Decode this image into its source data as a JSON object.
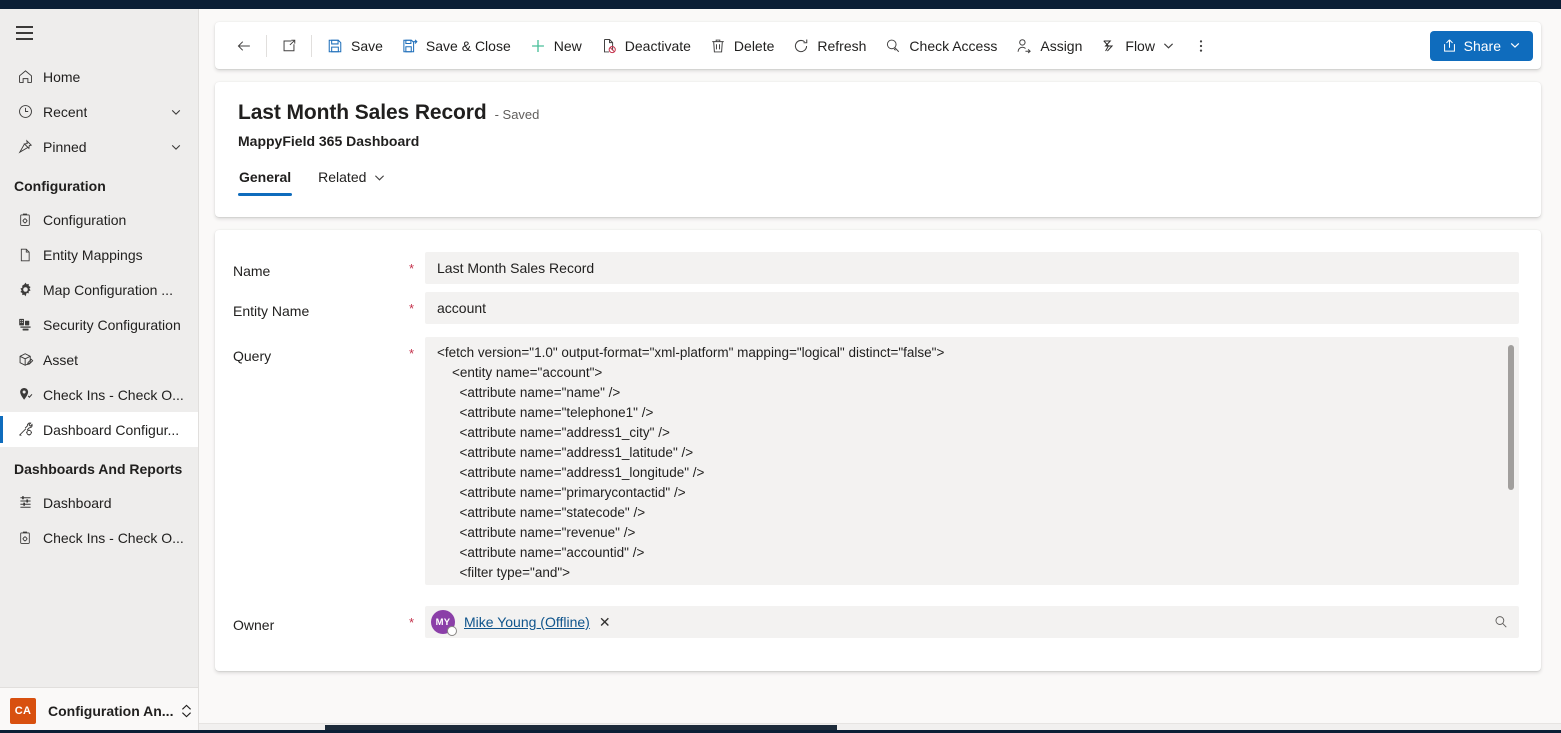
{
  "sidebar": {
    "menu_icon": "hamburger-icon",
    "top_items": [
      {
        "label": "Home",
        "icon": "home-icon",
        "chevron": false
      },
      {
        "label": "Recent",
        "icon": "clock-icon",
        "chevron": true
      },
      {
        "label": "Pinned",
        "icon": "pin-icon",
        "chevron": true
      }
    ],
    "groups": [
      {
        "title": "Configuration",
        "items": [
          {
            "label": "Configuration",
            "icon": "clipboard-gear-icon",
            "selected": false
          },
          {
            "label": "Entity Mappings",
            "icon": "document-icon",
            "selected": false
          },
          {
            "label": "Map Configuration ...",
            "icon": "gear-icon",
            "selected": false
          },
          {
            "label": "Security Configuration",
            "icon": "security-icon",
            "selected": false
          },
          {
            "label": "Asset",
            "icon": "box-pen-icon",
            "selected": false
          },
          {
            "label": "Check Ins - Check O...",
            "icon": "map-pin-check-icon",
            "selected": false
          },
          {
            "label": "Dashboard Configur...",
            "icon": "wrench-gear-icon",
            "selected": true
          }
        ]
      },
      {
        "title": "Dashboards And Reports",
        "items": [
          {
            "label": "Dashboard",
            "icon": "dashboard-icon",
            "selected": false
          },
          {
            "label": "Check Ins - Check O...",
            "icon": "clipboard-gear-icon",
            "selected": false
          }
        ]
      }
    ],
    "app_switcher": {
      "badge": "CA",
      "badge_color": "#d8500f",
      "name": "Configuration An...",
      "caret_icon": "chevron-updown-icon"
    }
  },
  "commandbar": {
    "back_icon": "arrow-left-icon",
    "popout_icon": "open-new-window-icon",
    "buttons": [
      {
        "label": "Save",
        "icon": "save-icon"
      },
      {
        "label": "Save & Close",
        "icon": "save-close-icon"
      },
      {
        "label": "New",
        "icon": "plus-icon"
      },
      {
        "label": "Deactivate",
        "icon": "deactivate-icon"
      },
      {
        "label": "Delete",
        "icon": "trash-icon"
      },
      {
        "label": "Refresh",
        "icon": "refresh-icon"
      },
      {
        "label": "Check Access",
        "icon": "key-icon"
      },
      {
        "label": "Assign",
        "icon": "person-assign-icon"
      },
      {
        "label": "Flow",
        "icon": "flow-icon",
        "has_caret": true
      }
    ],
    "overflow_icon": "more-vertical-icon",
    "share": {
      "label": "Share",
      "icon": "share-icon",
      "caret_icon": "chevron-down-icon",
      "color": "#0f6cbd"
    }
  },
  "header": {
    "title": "Last Month Sales Record",
    "status": "- Saved",
    "subtitle": "MappyField 365 Dashboard",
    "tabs": [
      {
        "label": "General",
        "active": true,
        "has_caret": false
      },
      {
        "label": "Related",
        "active": false,
        "has_caret": true
      }
    ]
  },
  "form": {
    "required_marker": "*",
    "fields": {
      "name": {
        "label": "Name",
        "value": "Last Month Sales Record",
        "required": true
      },
      "entity_name": {
        "label": "Entity Name",
        "value": "account",
        "required": true
      },
      "query": {
        "label": "Query",
        "required": true,
        "value": "<fetch version=\"1.0\" output-format=\"xml-platform\" mapping=\"logical\" distinct=\"false\">\n    <entity name=\"account\">\n      <attribute name=\"name\" />\n      <attribute name=\"telephone1\" />\n      <attribute name=\"address1_city\" />\n      <attribute name=\"address1_latitude\" />\n      <attribute name=\"address1_longitude\" />\n      <attribute name=\"primarycontactid\" />\n      <attribute name=\"statecode\" />\n      <attribute name=\"revenue\" />\n      <attribute name=\"accountid\" />\n      <filter type=\"and\">"
      },
      "owner": {
        "label": "Owner",
        "required": true,
        "chip": {
          "initials": "MY",
          "name": "Mike Young (Offline)",
          "avatar_color": "#8b3fa8",
          "remove_icon": "close-icon",
          "presence": "offline"
        },
        "search_icon": "lookup-search-icon"
      }
    }
  }
}
